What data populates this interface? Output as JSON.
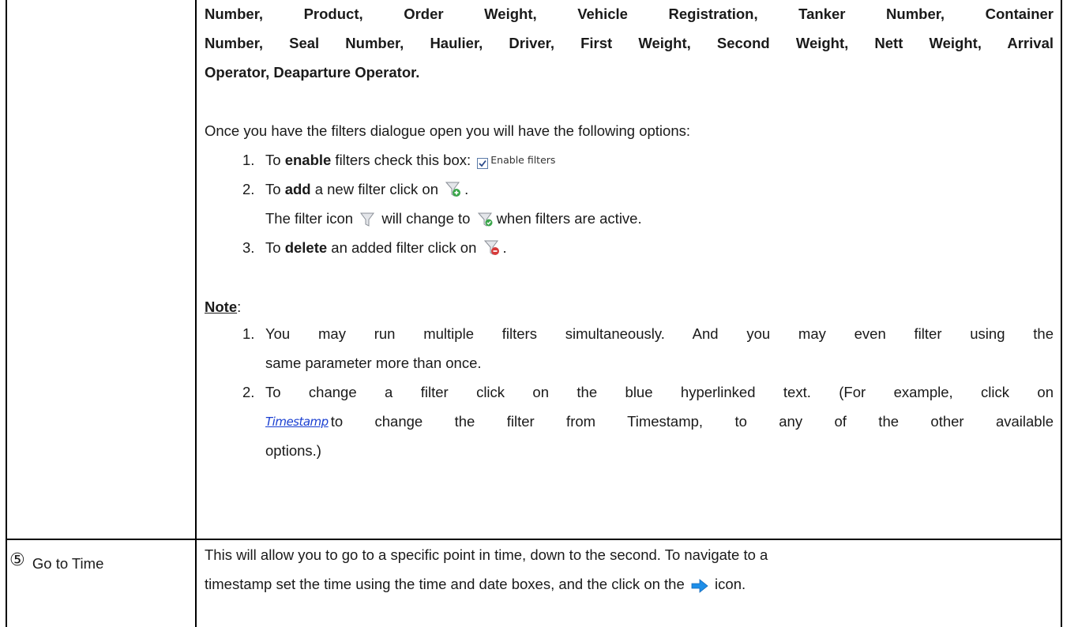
{
  "row_filters": {
    "fields_line1": "Number, Product, Order Weight, Vehicle Registration, Tanker Number, Container",
    "fields_line2": "Number, Seal Number, Haulier, Driver, First Weight, Second Weight, Nett Weight, Arrival",
    "fields_line3": "Operator, Deaparture Operator.",
    "intro": "Once you have the filters dialogue open you will have the following options:",
    "opt1_num": "1.",
    "opt1_pre": "To ",
    "opt1_bold": "enable",
    "opt1_post": " filters check this box:",
    "enable_filters_label": "Enable filters",
    "opt2_num": "2.",
    "opt2_pre": "To ",
    "opt2_bold": "add",
    "opt2_post": " a new filter click on",
    "opt2_end": ".",
    "opt2b_pre": "The filter icon",
    "opt2b_mid": "will change to",
    "opt2b_post": "when filters are active.",
    "opt3_num": "3.",
    "opt3_pre": "To ",
    "opt3_bold": "delete",
    "opt3_post": " an added filter click on",
    "opt3_end": ".",
    "note_label": "Note",
    "note_colon": ":",
    "note1_num": "1.",
    "note1_line1": "You may run multiple filters simultaneously. And you may even filter using the",
    "note1_line2": "same parameter more than once.",
    "note2_num": "2.",
    "note2_line1": "To change a filter click on the blue hyperlinked text. (For example, click on",
    "note2_link": "Timestamp",
    "note2_line2_post": "to change the filter from Timestamp, to any of the other available",
    "note2_line3": "options.)"
  },
  "row_goto": {
    "number": "⑤",
    "label": "Go to Time",
    "line1": "This will allow you to go to a specific point in time, down to the second. To navigate to a",
    "line2_pre": "timestamp set the time using the time and date boxes, and the click on the",
    "line2_post": "icon."
  },
  "colors": {
    "link": "#1a3fd1",
    "arrow": "#1e8ee8"
  }
}
